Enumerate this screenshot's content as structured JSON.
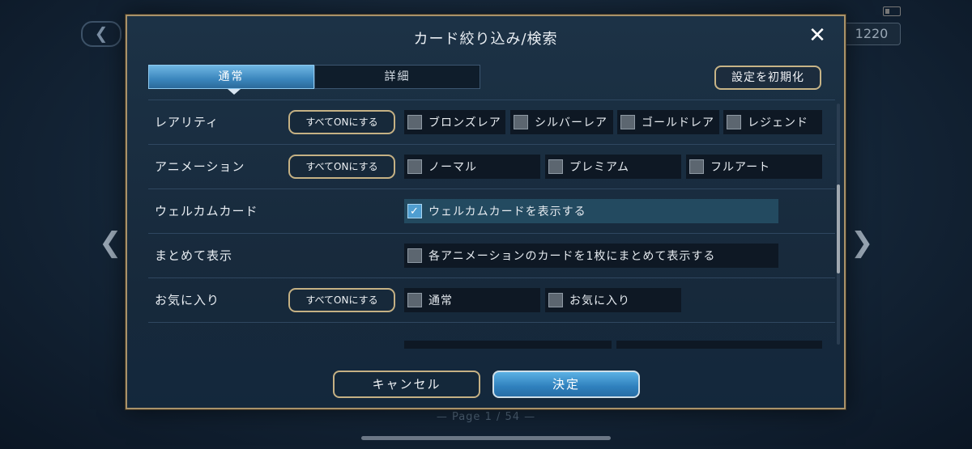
{
  "background": {
    "gold_value": "1220",
    "page_label": "— Page  1 / 54 —",
    "back_glyph": "❮",
    "nav_left_glyph": "❮",
    "nav_right_glyph": "❯"
  },
  "modal": {
    "title": "カード絞り込み/検索",
    "close_glyph": "✕",
    "tabs": [
      {
        "label": "通常",
        "active": true
      },
      {
        "label": "詳細",
        "active": false
      }
    ],
    "reset_label": "設定を初期化",
    "all_on_label": "すべてONにする",
    "rows": [
      {
        "label": "レアリティ",
        "has_all_on": true,
        "options": [
          {
            "label": "ブロンズレア",
            "checked": false
          },
          {
            "label": "シルバーレア",
            "checked": false
          },
          {
            "label": "ゴールドレア",
            "checked": false
          },
          {
            "label": "レジェンド",
            "checked": false
          }
        ]
      },
      {
        "label": "アニメーション",
        "has_all_on": true,
        "options": [
          {
            "label": "ノーマル",
            "checked": false
          },
          {
            "label": "プレミアム",
            "checked": false
          },
          {
            "label": "フルアート",
            "checked": false
          }
        ]
      },
      {
        "label": "ウェルカムカード",
        "has_all_on": false,
        "options": [
          {
            "label": "ウェルカムカードを表示する",
            "checked": true
          }
        ]
      },
      {
        "label": "まとめて表示",
        "has_all_on": false,
        "options": [
          {
            "label": "各アニメーションのカードを1枚にまとめて表示する",
            "checked": false
          }
        ]
      },
      {
        "label": "お気に入り",
        "has_all_on": true,
        "options": [
          {
            "label": "通常",
            "checked": false
          },
          {
            "label": "お気に入り",
            "checked": false
          }
        ]
      }
    ],
    "cancel_label": "キャンセル",
    "confirm_label": "決定"
  },
  "colors": {
    "accent": "#3b86bd",
    "gold_border": "#a8926a"
  }
}
